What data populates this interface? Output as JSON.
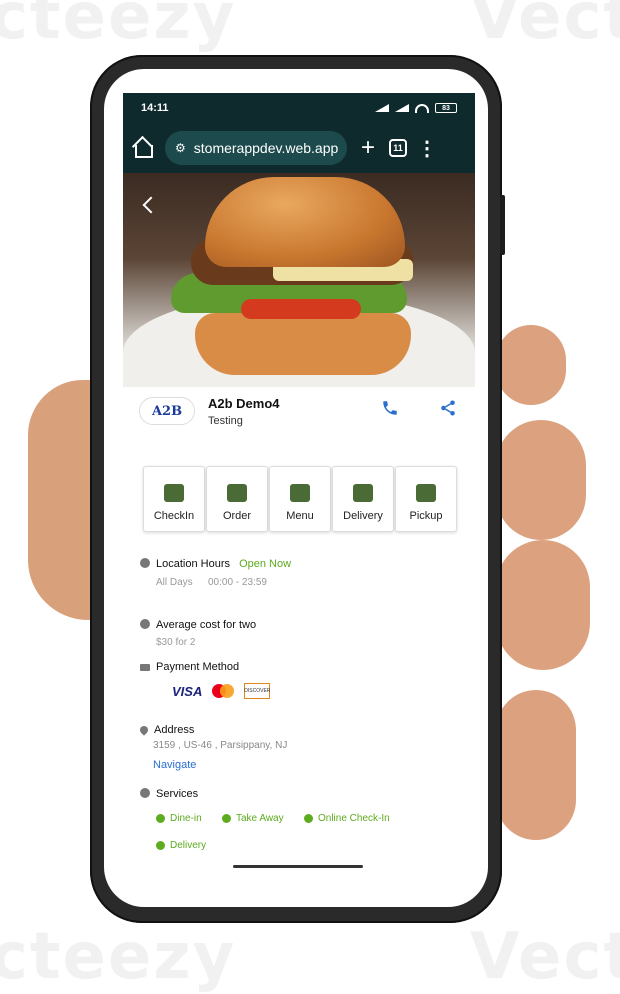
{
  "watermark": {
    "text": "Vecteezy"
  },
  "status_bar": {
    "time": "14:11",
    "battery": "83"
  },
  "browser": {
    "url": "stomerappdev.web.app",
    "tabs_count": "11"
  },
  "store": {
    "name": "A2b Demo4",
    "subtitle": "Testing",
    "logo_text": "A2B"
  },
  "actions": [
    {
      "label": "CheckIn",
      "icon": "table-icon"
    },
    {
      "label": "Order",
      "icon": "scooter-icon"
    },
    {
      "label": "Menu",
      "icon": "menu-book-icon"
    },
    {
      "label": "Delivery",
      "icon": "scooter-icon"
    },
    {
      "label": "Pickup",
      "icon": "bag-icon"
    }
  ],
  "hours": {
    "label": "Location Hours",
    "status": "Open Now",
    "days": "All Days",
    "time": "00:00 - 23:59"
  },
  "cost": {
    "label": "Average cost for two",
    "value": "$30 for 2"
  },
  "payment": {
    "label": "Payment Method",
    "cards": [
      "VISA",
      "DISCOVER"
    ]
  },
  "address": {
    "label": "Address",
    "line": "3159 , US-46 , Parsippany, NJ",
    "link": "Navigate"
  },
  "services": {
    "label": "Services",
    "items": [
      "Dine-in",
      "Take Away",
      "Online Check-In",
      "Delivery"
    ]
  }
}
